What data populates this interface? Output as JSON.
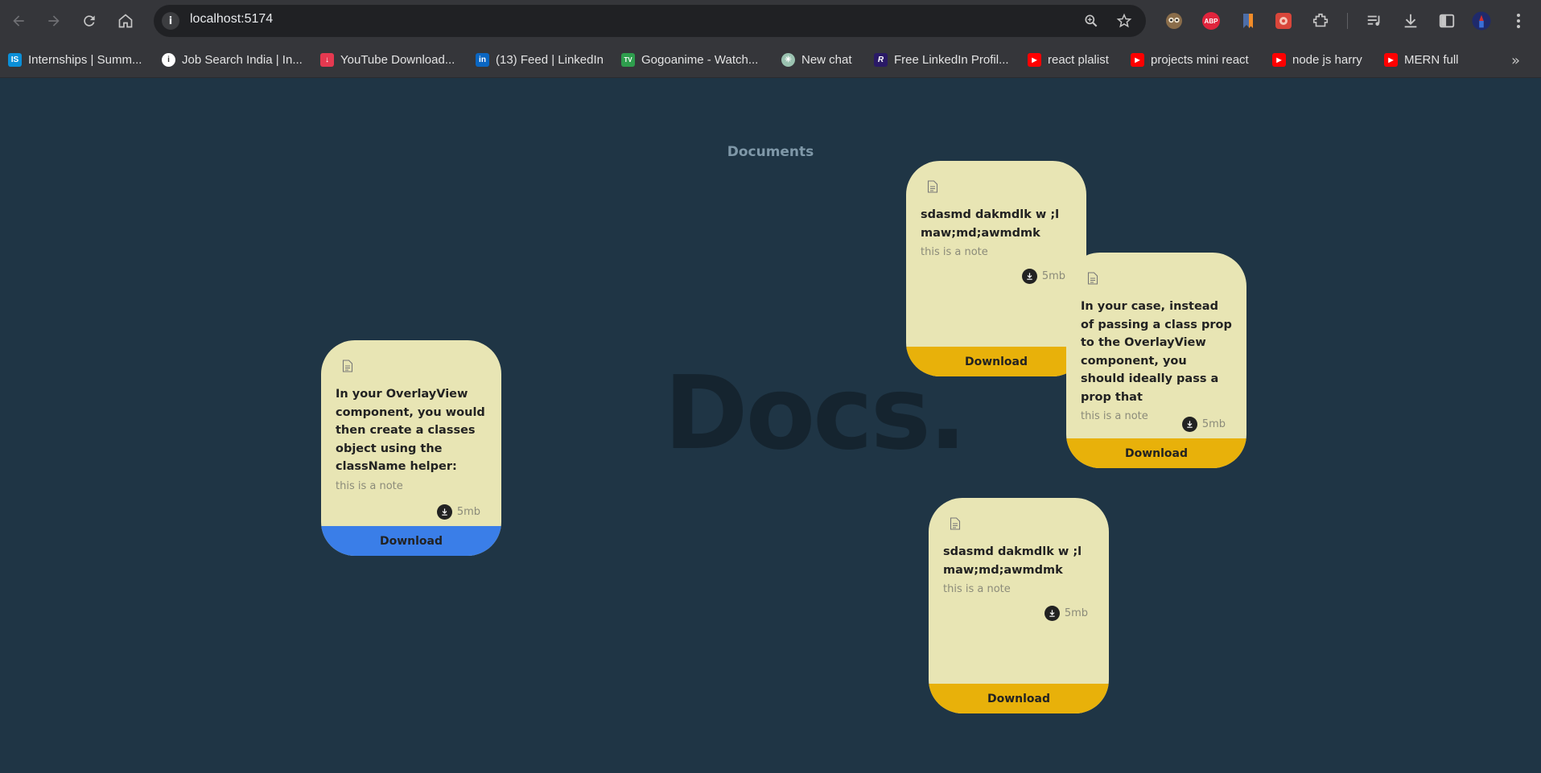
{
  "browser": {
    "url": "localhost:5174",
    "bookmarks": [
      {
        "label": "Internships | Summ...",
        "icon": "internshala-icon",
        "color": "#0a8fd8",
        "glyph": "IS"
      },
      {
        "label": "Job Search India | In...",
        "icon": "indeed-icon",
        "color": "#ffffff",
        "glyph": "i"
      },
      {
        "label": "YouTube Download...",
        "icon": "download-icon",
        "color": "#e53950",
        "glyph": "↓"
      },
      {
        "label": "(13) Feed | LinkedIn",
        "icon": "linkedin-icon",
        "color": "#0a66c2",
        "glyph": "in"
      },
      {
        "label": "Gogoanime - Watch...",
        "icon": "gogoanime-icon",
        "color": "#2e9e4d",
        "glyph": "TV"
      },
      {
        "label": "New chat",
        "icon": "chatgpt-icon",
        "color": "#9ac2b0",
        "glyph": "✳"
      },
      {
        "label": "Free LinkedIn Profil...",
        "icon": "resume-icon",
        "color": "#2a1a66",
        "glyph": "R"
      },
      {
        "label": "react plalist",
        "icon": "youtube-icon",
        "color": "#ff0000",
        "glyph": "▶"
      },
      {
        "label": "projects mini react",
        "icon": "youtube-icon",
        "color": "#ff0000",
        "glyph": "▶"
      },
      {
        "label": "node js harry",
        "icon": "youtube-icon",
        "color": "#ff0000",
        "glyph": "▶"
      },
      {
        "label": "MERN full",
        "icon": "youtube-icon",
        "color": "#ff0000",
        "glyph": "▶"
      }
    ],
    "extensions": {
      "abp_label": "ABP"
    }
  },
  "page": {
    "heading": "Documents",
    "background_logo": "Docs."
  },
  "cards": [
    {
      "title": "In your OverlayView component, you would then create a classes object using the className helper:",
      "note": "this is a note",
      "size": "5mb",
      "button": "Download",
      "button_color": "#3a7ee8"
    },
    {
      "title": "sdasmd dakmdlk w ;l maw;md;awmdmk",
      "note": "this is a note",
      "size": "5mb",
      "button": "Download",
      "button_color": "#e8b10a"
    },
    {
      "title": "In your case, instead of passing a class prop to the OverlayView component, you should ideally pass a prop that",
      "note": "this is a note",
      "size": "5mb",
      "button": "Download",
      "button_color": "#e8b10a"
    },
    {
      "title": "sdasmd dakmdlk w ;l maw;md;awmdmk",
      "note": "this is a note",
      "size": "5mb",
      "button": "Download",
      "button_color": "#e8b10a"
    }
  ]
}
